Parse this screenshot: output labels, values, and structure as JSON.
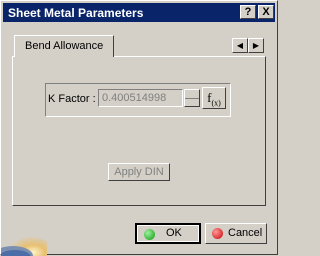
{
  "window": {
    "title": "Sheet Metal Parameters",
    "help_button": "?",
    "close_button": "X"
  },
  "tabs": [
    {
      "label": "Bend Allowance"
    }
  ],
  "tab_scroll": {
    "left_icon": "scroll-left-arrow",
    "right_icon": "scroll-right-arrow"
  },
  "bend_allowance": {
    "k_factor_label": "K Factor :",
    "k_factor_value": "0.400514998",
    "formula_button": "f(x)",
    "apply_label": "Apply DIN"
  },
  "footer": {
    "ok_label": "OK",
    "cancel_label": "Cancel"
  },
  "colors": {
    "title_bar": "#0a246a",
    "face": "#d4d0c8",
    "ok_icon": "#0a9a0a",
    "cancel_icon": "#c80000"
  }
}
